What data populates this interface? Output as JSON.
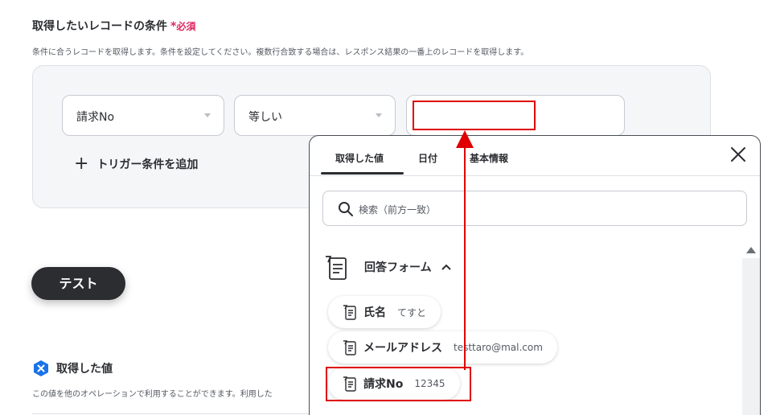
{
  "section": {
    "title": "取得したいレコードの条件",
    "required_mark": "*",
    "required_text": "必須",
    "description": "条件に合うレコードを取得します。条件を設定してください。複数行合致する場合は、レスポンス結果の一番上のレコードを取得します。"
  },
  "condition": {
    "field_select": "請求No",
    "operator_select": "等しい",
    "value": "",
    "add_trigger_icon": "+",
    "add_trigger_label": "トリガー条件を追加"
  },
  "test_button": "テスト",
  "acquired": {
    "badge_icon": "x-badge-icon",
    "title": "取得した値",
    "description": "この値を他のオペレーションで利用することができます。利用した"
  },
  "popup": {
    "tabs": [
      "取得した値",
      "日付",
      "基本情報"
    ],
    "active_tab": 0,
    "search_placeholder": "検索（前方一致）",
    "group_label": "回答フォーム",
    "items": [
      {
        "name": "氏名",
        "value": "てすと"
      },
      {
        "name": "メールアドレス",
        "value": "testtaro@mal.com"
      },
      {
        "name": "請求No",
        "value": "12345"
      }
    ]
  },
  "colors": {
    "highlight": "#e00000",
    "required": "#e0245e",
    "badge": "#1a73e8",
    "dark": "#2b2d31"
  }
}
